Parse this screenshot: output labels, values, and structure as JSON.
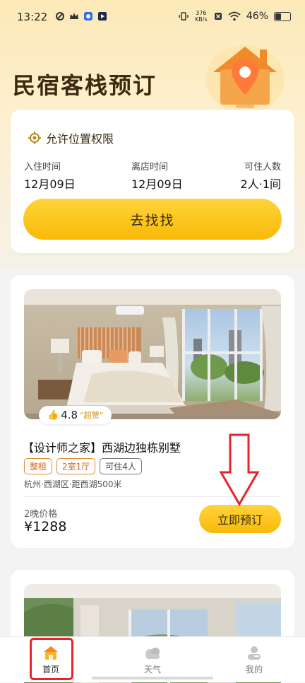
{
  "status_bar": {
    "time": "13:22",
    "net_speed_value": "376",
    "net_speed_unit": "KB/s",
    "battery": "46%"
  },
  "page": {
    "title": "民宿客栈预订"
  },
  "booking": {
    "location_permission": "允许位置权限",
    "checkin_label": "入住时间",
    "checkin_value": "12月09日",
    "checkout_label": "离店时间",
    "checkout_value": "12月09日",
    "guests_label": "可住人数",
    "guests_value": "2人·1间",
    "search_button": "去找找"
  },
  "listing": {
    "rating": "4.8",
    "rating_tag": "“超赞”",
    "title": "【设计师之家】西湖边独栋别墅",
    "tags": [
      "整租",
      "2室1厅",
      "可住4人"
    ],
    "location": "杭州·西湖区·距西湖500米",
    "price_label": "2晚价格",
    "price": "¥1288",
    "book_button": "立即预订"
  },
  "tabs": [
    {
      "label": "首页",
      "icon": "home-icon",
      "active": true
    },
    {
      "label": "天气",
      "icon": "cloud-icon",
      "active": false
    },
    {
      "label": "我的",
      "icon": "user-icon",
      "active": false
    }
  ],
  "colors": {
    "accent": "#f9b90a",
    "annotation": "#e8232a"
  }
}
